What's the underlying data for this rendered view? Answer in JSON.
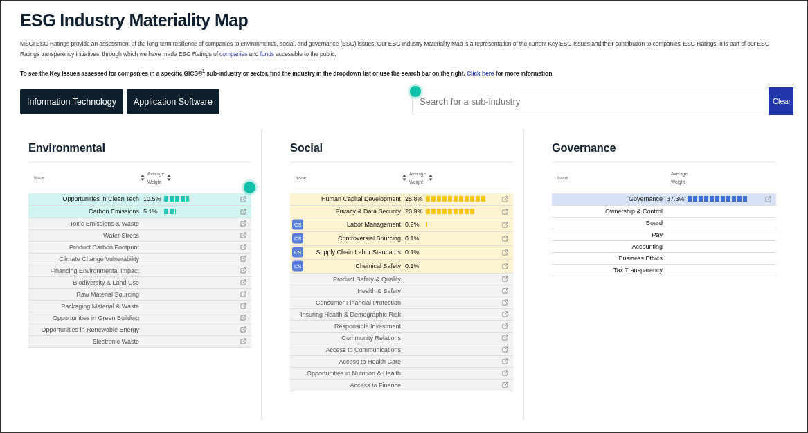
{
  "title": "ESG Industry Materiality Map",
  "intro": "MSCI ESG Ratings provide an assessment of the long-term resilience of companies to environmental, social, and governance (ESG) issues. Our ESG Industry Materiality Map is a representation of the current Key ESG Issues and their contribution to companies' ESG Ratings. It is part of our ESG Ratings transparency initiatives, through which we have made ESG Ratings of ",
  "intro_links": [
    "companies",
    "funds"
  ],
  "intro_join": " and ",
  "intro_end": " accessible to the public.",
  "instruction": "To see the Key Issues assessed for companies in a specific GICS®$^{1}$ sub-industry or sector, find the industry in the dropdown list or use the search bar on the right. ",
  "instruction_link": "Click here",
  "instruction_end": " for more information.",
  "industry_buttons": [
    "Information Technology",
    "Application Software"
  ],
  "search": {
    "placeholder": "Search for a sub-industry",
    "button": "Clear"
  },
  "pillars": [
    {
      "title": "Environmental",
      "color": "#1fc7b3",
      "issue_header": "Issue",
      "weight_header": [
        "Average",
        "Weight"
      ],
      "sortable": true,
      "rows": [
        {
          "kind": "key",
          "issue": "Opportunities in Clean Tech",
          "weight": "10.5%",
          "cs": false
        },
        {
          "kind": "key",
          "issue": "Carbon Emissions",
          "weight": "5.1%",
          "cs": false
        },
        {
          "kind": "other",
          "issue": "Toxic Emissions & Waste",
          "cs": false
        },
        {
          "kind": "other",
          "issue": "Water Stress",
          "cs": false
        },
        {
          "kind": "other",
          "issue": "Product Carbon Footprint",
          "cs": false
        },
        {
          "kind": "other",
          "issue": "Climate Change Vulnerability",
          "cs": false
        },
        {
          "kind": "other",
          "issue": "Financing Environmental Impact",
          "cs": false
        },
        {
          "kind": "other",
          "issue": "Biodiversity & Land Use",
          "cs": false
        },
        {
          "kind": "other",
          "issue": "Raw Material Sourcing",
          "cs": false
        },
        {
          "kind": "other",
          "issue": "Packaging Material & Waste",
          "cs": false
        },
        {
          "kind": "other",
          "issue": "Opportunities in Green Building",
          "cs": false
        },
        {
          "kind": "other",
          "issue": "Opportunities in Renewable Energy",
          "cs": false
        },
        {
          "kind": "other",
          "issue": "Electronic Waste",
          "cs": false
        }
      ]
    },
    {
      "title": "Social",
      "color": "#f5c414",
      "issue_header": "Issue",
      "weight_header": [
        "Average",
        "Weight"
      ],
      "sortable": true,
      "rows": [
        {
          "kind": "key",
          "issue": "Human Capital Development",
          "weight": "25.8%",
          "cs": false
        },
        {
          "kind": "key",
          "issue": "Privacy & Data Security",
          "weight": "20.9%",
          "cs": false
        },
        {
          "kind": "key",
          "issue": "Labor Management",
          "weight": "0.2%",
          "cs": true,
          "badge": "CS"
        },
        {
          "kind": "key",
          "issue": "Controversial Sourcing",
          "weight": "0.1%",
          "cs": true,
          "badge": "CS"
        },
        {
          "kind": "key",
          "issue": "Supply Chain Labor Standards",
          "weight": "0.1%",
          "cs": true,
          "badge": "CS"
        },
        {
          "kind": "key",
          "issue": "Chemical Safety",
          "weight": "0.1%",
          "cs": true,
          "badge": "CS"
        },
        {
          "kind": "other",
          "issue": "Product Safety & Quality",
          "cs": false
        },
        {
          "kind": "other",
          "issue": "Health & Safety",
          "cs": false
        },
        {
          "kind": "other",
          "issue": "Consumer Financial Protection",
          "cs": false
        },
        {
          "kind": "other",
          "issue": "Insuring Health & Demographic Risk",
          "cs": false
        },
        {
          "kind": "other",
          "issue": "Responsible Investment",
          "cs": false
        },
        {
          "kind": "other",
          "issue": "Community Relations",
          "cs": false
        },
        {
          "kind": "other",
          "issue": "Access to Communications",
          "cs": false
        },
        {
          "kind": "other",
          "issue": "Access to Health Care",
          "cs": false
        },
        {
          "kind": "other",
          "issue": "Opportunities in Nutrition & Health",
          "cs": false
        },
        {
          "kind": "other",
          "issue": "Access to Finance",
          "cs": false
        }
      ]
    },
    {
      "title": "Governance",
      "color": "#3d6fd6",
      "issue_header": "Issue",
      "weight_header": [
        "Average",
        "Weight"
      ],
      "sortable": false,
      "rows": [
        {
          "kind": "key",
          "issue": "Governance",
          "weight": "37.3%",
          "cs": false
        },
        {
          "kind": "sub",
          "issue": "Ownership & Control",
          "cs": false
        },
        {
          "kind": "sub",
          "issue": "Board",
          "cs": false
        },
        {
          "kind": "sub",
          "issue": "Pay",
          "cs": false
        },
        {
          "kind": "sub",
          "issue": "Accounting",
          "cs": false
        },
        {
          "kind": "sub",
          "issue": "Business Ethics",
          "cs": false
        },
        {
          "kind": "sub",
          "issue": "Tax Transparency",
          "cs": false
        }
      ]
    }
  ]
}
